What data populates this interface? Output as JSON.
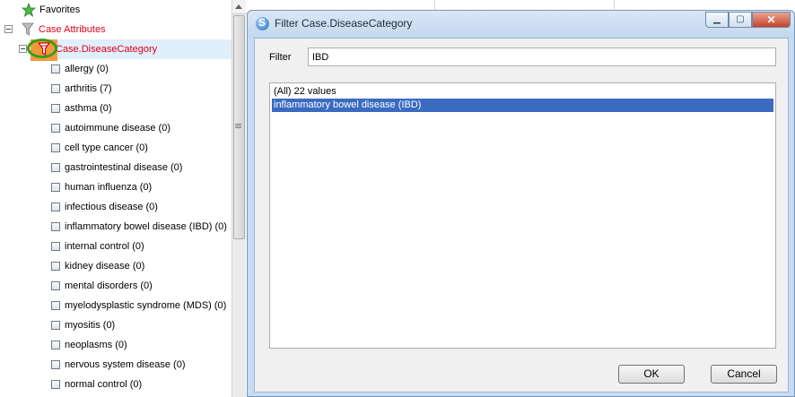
{
  "tree": {
    "favorites_label": "Favorites",
    "case_attributes_label": "Case Attributes",
    "category_label": "Case.DiseaseCategory",
    "items": [
      "allergy (0)",
      "arthritis (7)",
      "asthma (0)",
      "autoimmune disease (0)",
      "cell type cancer (0)",
      "gastrointestinal disease (0)",
      "human influenza (0)",
      "infectious disease (0)",
      "inflammatory bowel disease (IBD) (0)",
      "internal control (0)",
      "kidney disease (0)",
      "mental disorders (0)",
      "myelodysplastic syndrome (MDS) (0)",
      "myositis (0)",
      "neoplasms (0)",
      "nervous system disease (0)",
      "normal control (0)"
    ]
  },
  "dialog": {
    "title": "Filter Case.DiseaseCategory",
    "minimize_glyph": "▁",
    "maximize_glyph": "▢",
    "close_glyph": "✕",
    "filter_label": "Filter",
    "filter_value": "IBD",
    "list": [
      {
        "text": "(All) 22 values",
        "selected": false
      },
      {
        "text": "inflammatory bowel disease (IBD)",
        "selected": true
      }
    ],
    "ok_label": "OK",
    "cancel_label": "Cancel"
  },
  "icons": {
    "favorites": "star-icon",
    "case_attributes": "funnel-icon",
    "category": "funnel-icon",
    "app": "app-logo-icon"
  },
  "colors": {
    "attribute_text": "#e0001b",
    "selection": "#3a6bc1",
    "highlight_marker": "#f19a3a",
    "circle_marker": "#3b9c1e"
  }
}
